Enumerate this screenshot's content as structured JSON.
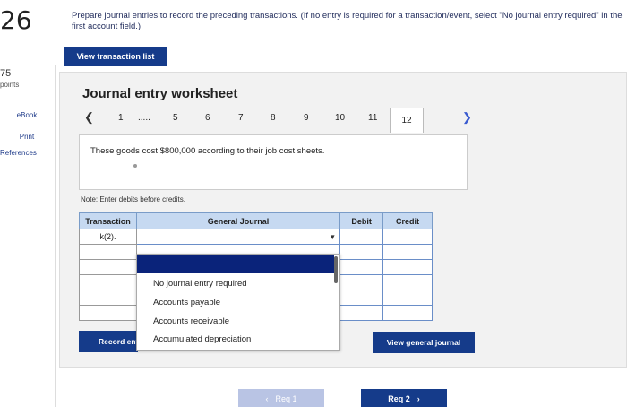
{
  "question": {
    "number": "26",
    "prompt": "Prepare journal entries to record the preceding transactions. (If no entry is required for a transaction/event, select \"No journal entry required\" in the first account field.)",
    "view_transaction_list_label": "View transaction list"
  },
  "sidebar": {
    "points_value": "75",
    "points_label": "points",
    "links": [
      "eBook",
      "Print",
      "References"
    ]
  },
  "worksheet": {
    "title": "Journal entry worksheet",
    "pager": {
      "prev_icon": "chevron-left-icon",
      "next_icon": "chevron-right-icon",
      "items": [
        "1",
        ".....",
        "5",
        "6",
        "7",
        "8",
        "9",
        "10",
        "11",
        "12"
      ],
      "active": "12"
    },
    "description": "These goods cost $800,000 according to their job cost sheets.",
    "note": "Note: Enter debits before credits.",
    "table": {
      "headers": [
        "Transaction",
        "General Journal",
        "Debit",
        "Credit"
      ],
      "rows": [
        {
          "transaction": "k(2).",
          "account": "",
          "debit": "",
          "credit": ""
        },
        {
          "transaction": "",
          "account": "",
          "debit": "",
          "credit": ""
        },
        {
          "transaction": "",
          "account": "",
          "debit": "",
          "credit": ""
        },
        {
          "transaction": "",
          "account": "",
          "debit": "",
          "credit": ""
        },
        {
          "transaction": "",
          "account": "",
          "debit": "",
          "credit": ""
        },
        {
          "transaction": "",
          "account": "",
          "debit": "",
          "credit": ""
        }
      ]
    },
    "dropdown_options": [
      "No journal entry required",
      "Accounts payable",
      "Accounts receivable",
      "Accumulated depreciation"
    ],
    "record_entry_label": "Record entry",
    "view_general_journal_label": "View general journal"
  },
  "footer": {
    "req1_label": "Req 1",
    "req2_label": "Req 2"
  },
  "colors": {
    "primary_button": "#153b8a",
    "header_fill": "#c6d9f1",
    "dropdown_highlight": "#0a237a",
    "disabled_button": "#b9c4e4"
  }
}
